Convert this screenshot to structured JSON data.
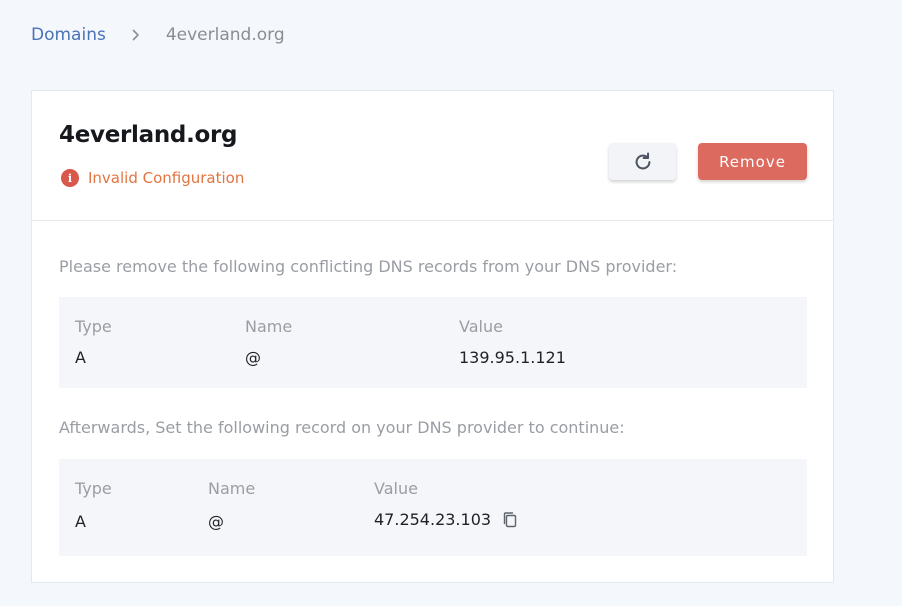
{
  "breadcrumb": {
    "parent": "Domains",
    "separator_icon": "chevron-right-icon",
    "current": "4everland.org"
  },
  "domain": {
    "name": "4everland.org",
    "status_icon": "info-icon",
    "status_icon_glyph": "i",
    "status_text": "Invalid Configuration",
    "status_color": "#e3743f"
  },
  "actions": {
    "refresh_icon": "refresh-icon",
    "remove_label": "Remove",
    "remove_color": "#dd6a5e"
  },
  "conflict": {
    "instruction": "Please remove the following conflicting DNS records from your DNS provider:",
    "headers": {
      "type": "Type",
      "name": "Name",
      "value": "Value"
    },
    "record": {
      "type": "A",
      "name": "@",
      "value": "139.95.1.121"
    }
  },
  "required": {
    "instruction": "Afterwards, Set the following record on your DNS provider to continue:",
    "headers": {
      "type": "Type",
      "name": "Name",
      "value": "Value"
    },
    "record": {
      "type": "A",
      "name": "@",
      "value": "47.254.23.103"
    },
    "copy_icon": "copy-icon"
  }
}
